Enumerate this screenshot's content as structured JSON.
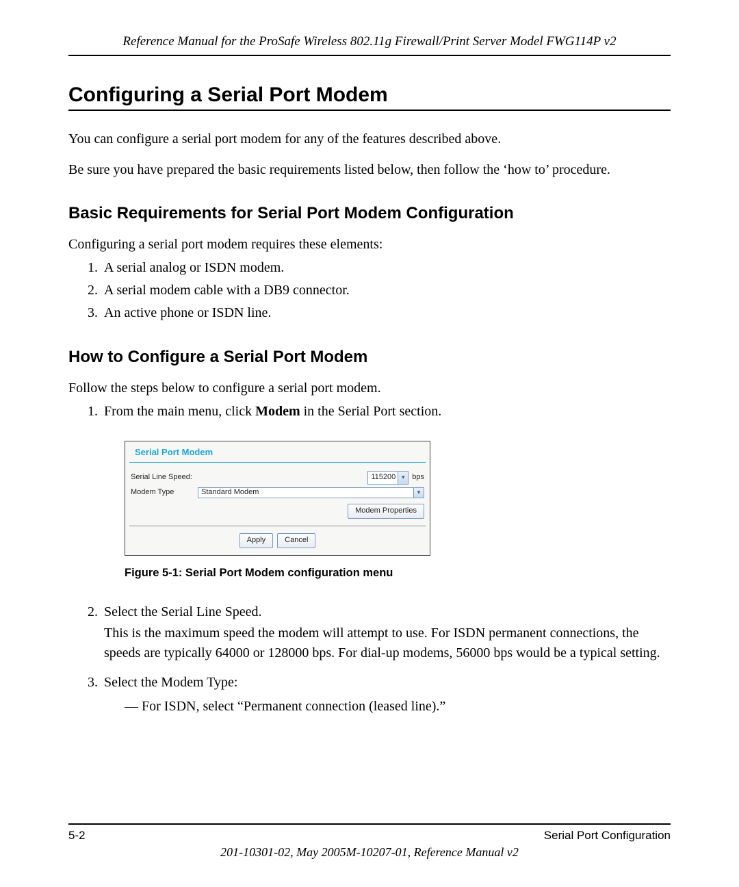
{
  "header": {
    "running": "Reference Manual for the ProSafe Wireless 802.11g  Firewall/Print Server Model FWG114P v2"
  },
  "titles": {
    "main": "Configuring a Serial Port Modem",
    "basic": "Basic Requirements for Serial Port Modem Configuration",
    "howto": "How to Configure a Serial Port Modem"
  },
  "paras": {
    "intro1": "You can configure a serial port modem for any of the features described above.",
    "intro2": "Be sure you have prepared the basic requirements listed below, then follow the ‘how to’ procedure.",
    "basic_lead": "Configuring a serial port modem requires these elements:",
    "howto_lead": "Follow the steps below to configure a serial port modem."
  },
  "basic_items": [
    "A serial analog or ISDN modem.",
    "A serial modem cable with a DB9 connector.",
    "An active phone or ISDN line."
  ],
  "steps": {
    "s1_pre": "From the main menu, click ",
    "s1_bold": "Modem",
    "s1_post": " in the Serial Port section.",
    "s2_lead": "Select the Serial Line Speed.",
    "s2_body": "This is the maximum speed the modem will attempt to use. For ISDN permanent connections, the speeds are typically 64000 or 128000 bps. For dial-up modems, 56000 bps would be a typical setting.",
    "s3_lead": "Select the Modem Type:",
    "s3_sub": "—  For ISDN, select “Permanent connection (leased line).”"
  },
  "figure": {
    "panel_title": "Serial Port Modem",
    "speed_label": "Serial Line Speed:",
    "speed_value": "115200",
    "speed_unit": "bps",
    "type_label": "Modem Type",
    "type_value": "Standard Modem",
    "props_btn": "Modem Properties",
    "apply_btn": "Apply",
    "cancel_btn": "Cancel",
    "caption": "Figure 5-1:  Serial Port Modem configuration menu"
  },
  "footer": {
    "left": "5-2",
    "right": "Serial Port Configuration",
    "bottom": "201-10301-02, May 2005M-10207-01, Reference Manual v2"
  }
}
